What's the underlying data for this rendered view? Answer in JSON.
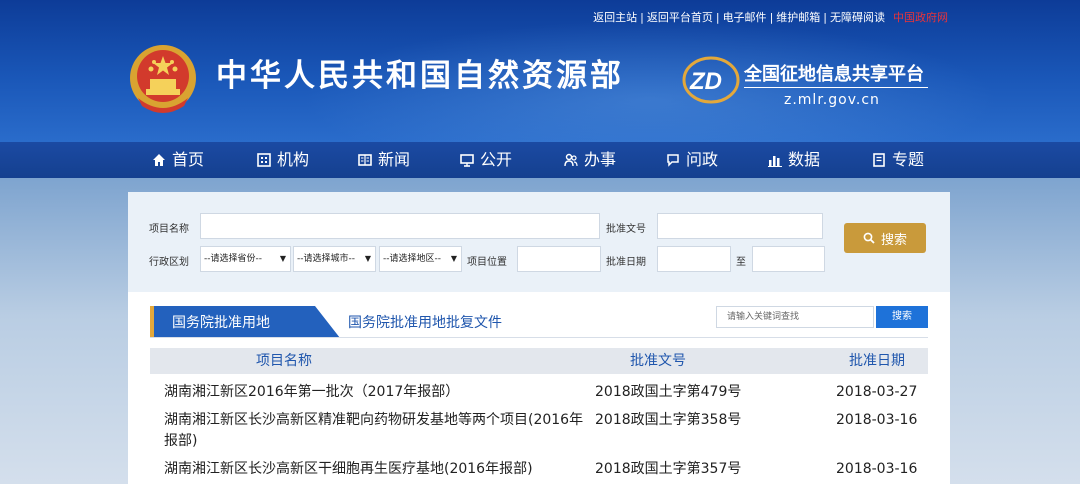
{
  "top_links": [
    "返回主站",
    "返回平台首页",
    "电子邮件",
    "维护邮箱",
    "无障碍阅读"
  ],
  "top_link_gov": "中国政府网",
  "site_title": "中华人民共和国自然资源部",
  "platform": {
    "logo_text": "ZD",
    "name": "全国征地信息共享平台",
    "url": "z.mlr.gov.cn"
  },
  "nav": [
    {
      "label": "首页",
      "icon": "home-icon"
    },
    {
      "label": "机构",
      "icon": "building-icon"
    },
    {
      "label": "新闻",
      "icon": "newspaper-icon"
    },
    {
      "label": "公开",
      "icon": "monitor-icon"
    },
    {
      "label": "办事",
      "icon": "people-icon"
    },
    {
      "label": "问政",
      "icon": "chat-icon"
    },
    {
      "label": "数据",
      "icon": "bar-chart-icon"
    },
    {
      "label": "专题",
      "icon": "book-icon"
    }
  ],
  "search": {
    "project_name_label": "项目名称",
    "approval_no_label": "批准文号",
    "region_label": "行政区划",
    "province_select": "--请选择省份--",
    "city_select": "--请选择城市--",
    "district_select": "--请选择地区--",
    "location_label": "项目位置",
    "approval_date_label": "批准日期",
    "to_label": "至",
    "button_label": "搜索"
  },
  "tabs": {
    "active": "国务院批准用地",
    "inactive": "国务院批准用地批复文件"
  },
  "keyword": {
    "placeholder": "请输入关键词查找",
    "button": "搜索"
  },
  "table": {
    "headers": [
      "项目名称",
      "批准文号",
      "批准日期"
    ],
    "rows": [
      {
        "name": "湖南湘江新区2016年第一批次（2017年报部）",
        "doc": "2018政国土字第479号",
        "date": "2018-03-27"
      },
      {
        "name_line1": "湖南湘江新区长沙高新区精准靶向药物研发基地等两个项目(2016年",
        "name_line2": "报部)",
        "doc": "2018政国土字第358号",
        "date": "2018-03-16"
      },
      {
        "name": "湖南湘江新区长沙高新区干细胞再生医疗基地(2016年报部)",
        "doc": "2018政国土字第357号",
        "date": "2018-03-16"
      }
    ]
  },
  "colors": {
    "header_blue": "#1a57b8",
    "nav_blue": "#15408f",
    "gold_button": "#c99a3b",
    "link_blue": "#1f56ad",
    "search_blue": "#1e72d9",
    "gov_red": "#e8333a"
  }
}
